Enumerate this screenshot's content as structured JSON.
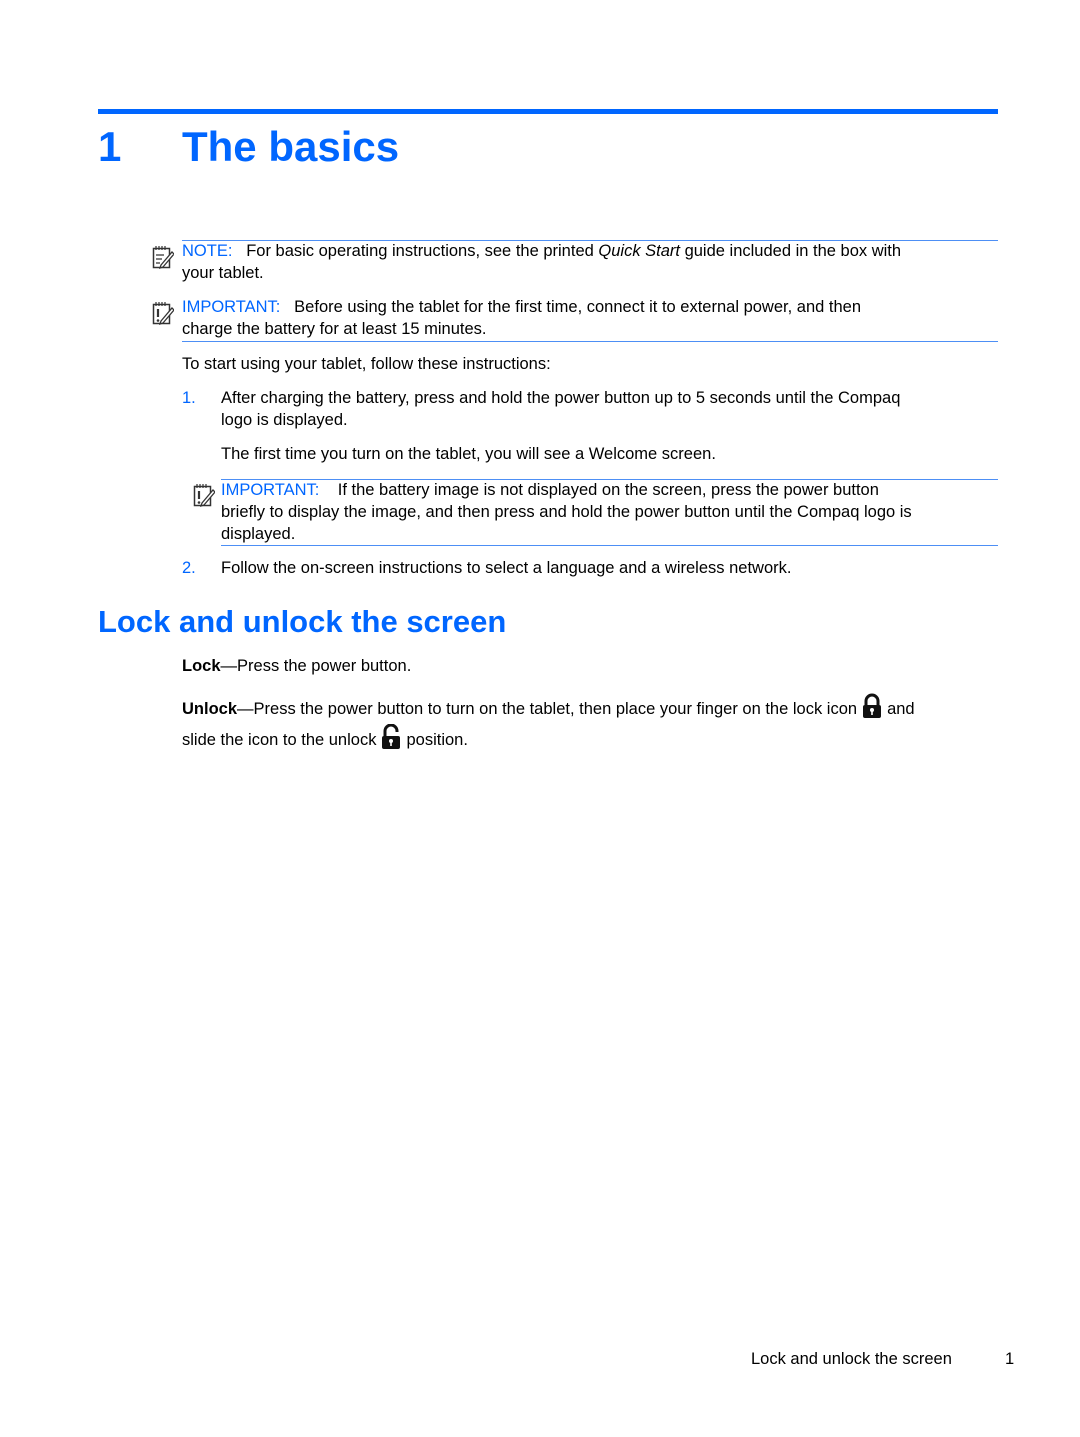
{
  "chapter": {
    "number": "1",
    "title": "The basics"
  },
  "note": {
    "label": "NOTE:",
    "text_before": "For basic operating instructions, see the printed ",
    "text_italic": "Quick Start",
    "text_after": " guide included in the box with",
    "text_line2": "your tablet."
  },
  "important1": {
    "label": "IMPORTANT:",
    "text_line1": "Before using the tablet for the first time, connect it to external power, and then",
    "text_line2": "charge the battery for at least 15 minutes."
  },
  "intro": "To start using your tablet, follow these instructions:",
  "steps": [
    {
      "number": "1.",
      "line1": "After charging the battery, press and hold the power button up to 5 seconds until the Compaq",
      "line2": "logo is displayed.",
      "followup": "The first time you turn on the tablet, you will see a Welcome screen.",
      "important": {
        "label": "IMPORTANT:",
        "line1": "If the battery image is not displayed on the screen, press the power button",
        "line2": "briefly to display the image, and then press and hold the power button until the Compaq logo is",
        "line3": "displayed."
      }
    },
    {
      "number": "2.",
      "line1": "Follow the on-screen instructions to select a language and a wireless network."
    }
  ],
  "section": {
    "title": "Lock and unlock the screen",
    "lock": {
      "term": "Lock",
      "text": "—Press the power button."
    },
    "unlock": {
      "term": "Unlock",
      "text_line1": "—Press the power button to turn on the tablet, then place your finger on the lock icon",
      "text_line1_end": "and",
      "text_line2_start": "slide the icon to the unlock",
      "text_line2_end": "position."
    }
  },
  "footer": {
    "section_name": "Lock and unlock the screen",
    "page_number": "1"
  },
  "icons": {
    "note": "note-pencil-icon",
    "important": "important-pencil-icon",
    "lock": "padlock-closed-icon",
    "unlock": "padlock-open-icon"
  },
  "colors": {
    "accent": "#0066ff",
    "rule": "#4d8ff5",
    "text": "#000000"
  }
}
